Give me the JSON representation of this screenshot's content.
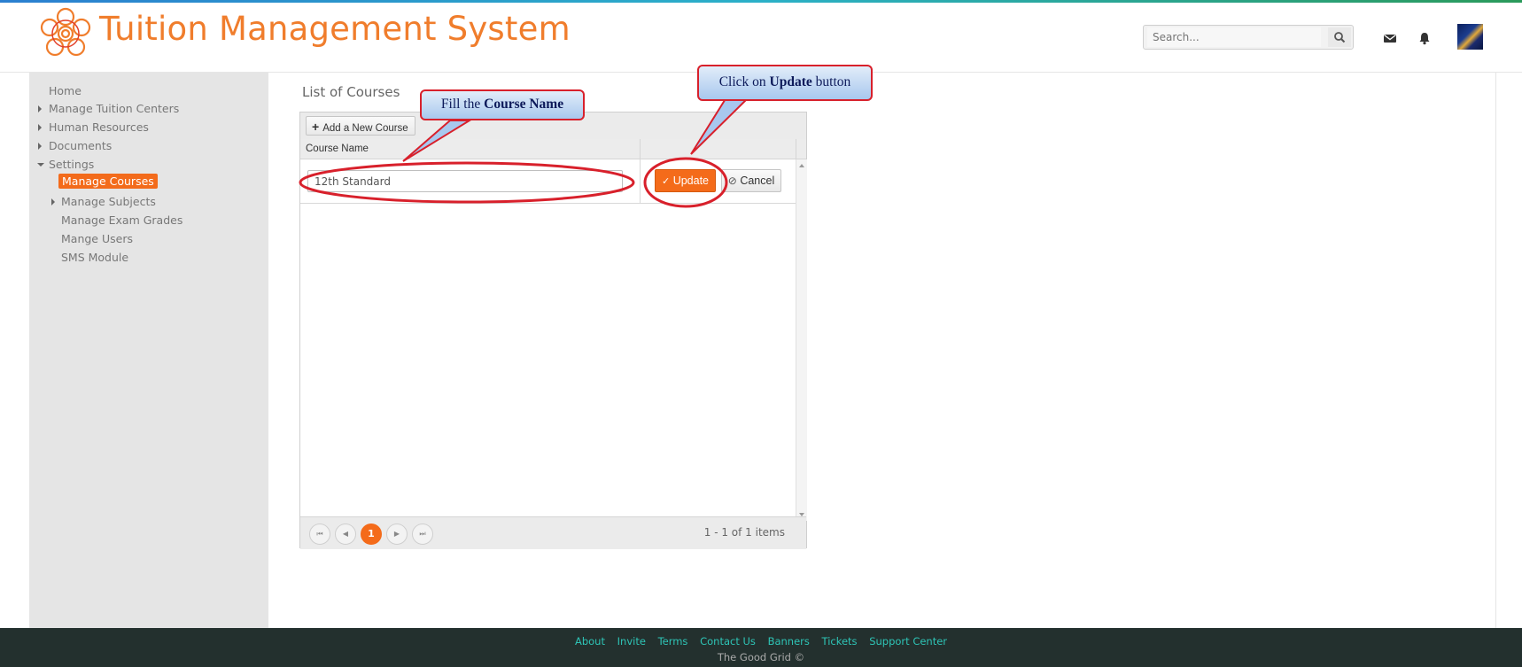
{
  "header": {
    "title": "Tuition Management System",
    "search_placeholder": "Search..."
  },
  "sidebar": {
    "items": [
      {
        "label": "Home"
      },
      {
        "label": "Manage Tuition Centers"
      },
      {
        "label": "Human Resources"
      },
      {
        "label": "Documents"
      },
      {
        "label": "Settings"
      },
      {
        "label": "Manage Courses"
      },
      {
        "label": "Manage Subjects"
      },
      {
        "label": "Manage Exam Grades"
      },
      {
        "label": "Mange Users"
      },
      {
        "label": "SMS Module"
      }
    ]
  },
  "main": {
    "title": "List of Courses",
    "add_button": "Add a New Course",
    "column_header": "Course Name",
    "edit_value": "12th Standard",
    "update_button": "Update",
    "cancel_button": "Cancel",
    "pager": {
      "current_page": "1",
      "info": "1 - 1 of 1 items"
    }
  },
  "callouts": {
    "course_name": {
      "prefix": "Fill the ",
      "bold": "Course Name",
      "suffix": ""
    },
    "update": {
      "prefix": "Click on ",
      "bold": "Update",
      "suffix": " button"
    }
  },
  "footer": {
    "links": [
      "About",
      "Invite",
      "Terms",
      "Contact Us",
      "Banners",
      "Tickets",
      "Support Center"
    ],
    "copyright": "The Good Grid ©"
  },
  "colors": {
    "accent": "#f46b1a",
    "title": "#f07d2c",
    "annotation_red": "#d8202b",
    "footer_link": "#2ec4b6",
    "footer_bg": "#23302e"
  }
}
